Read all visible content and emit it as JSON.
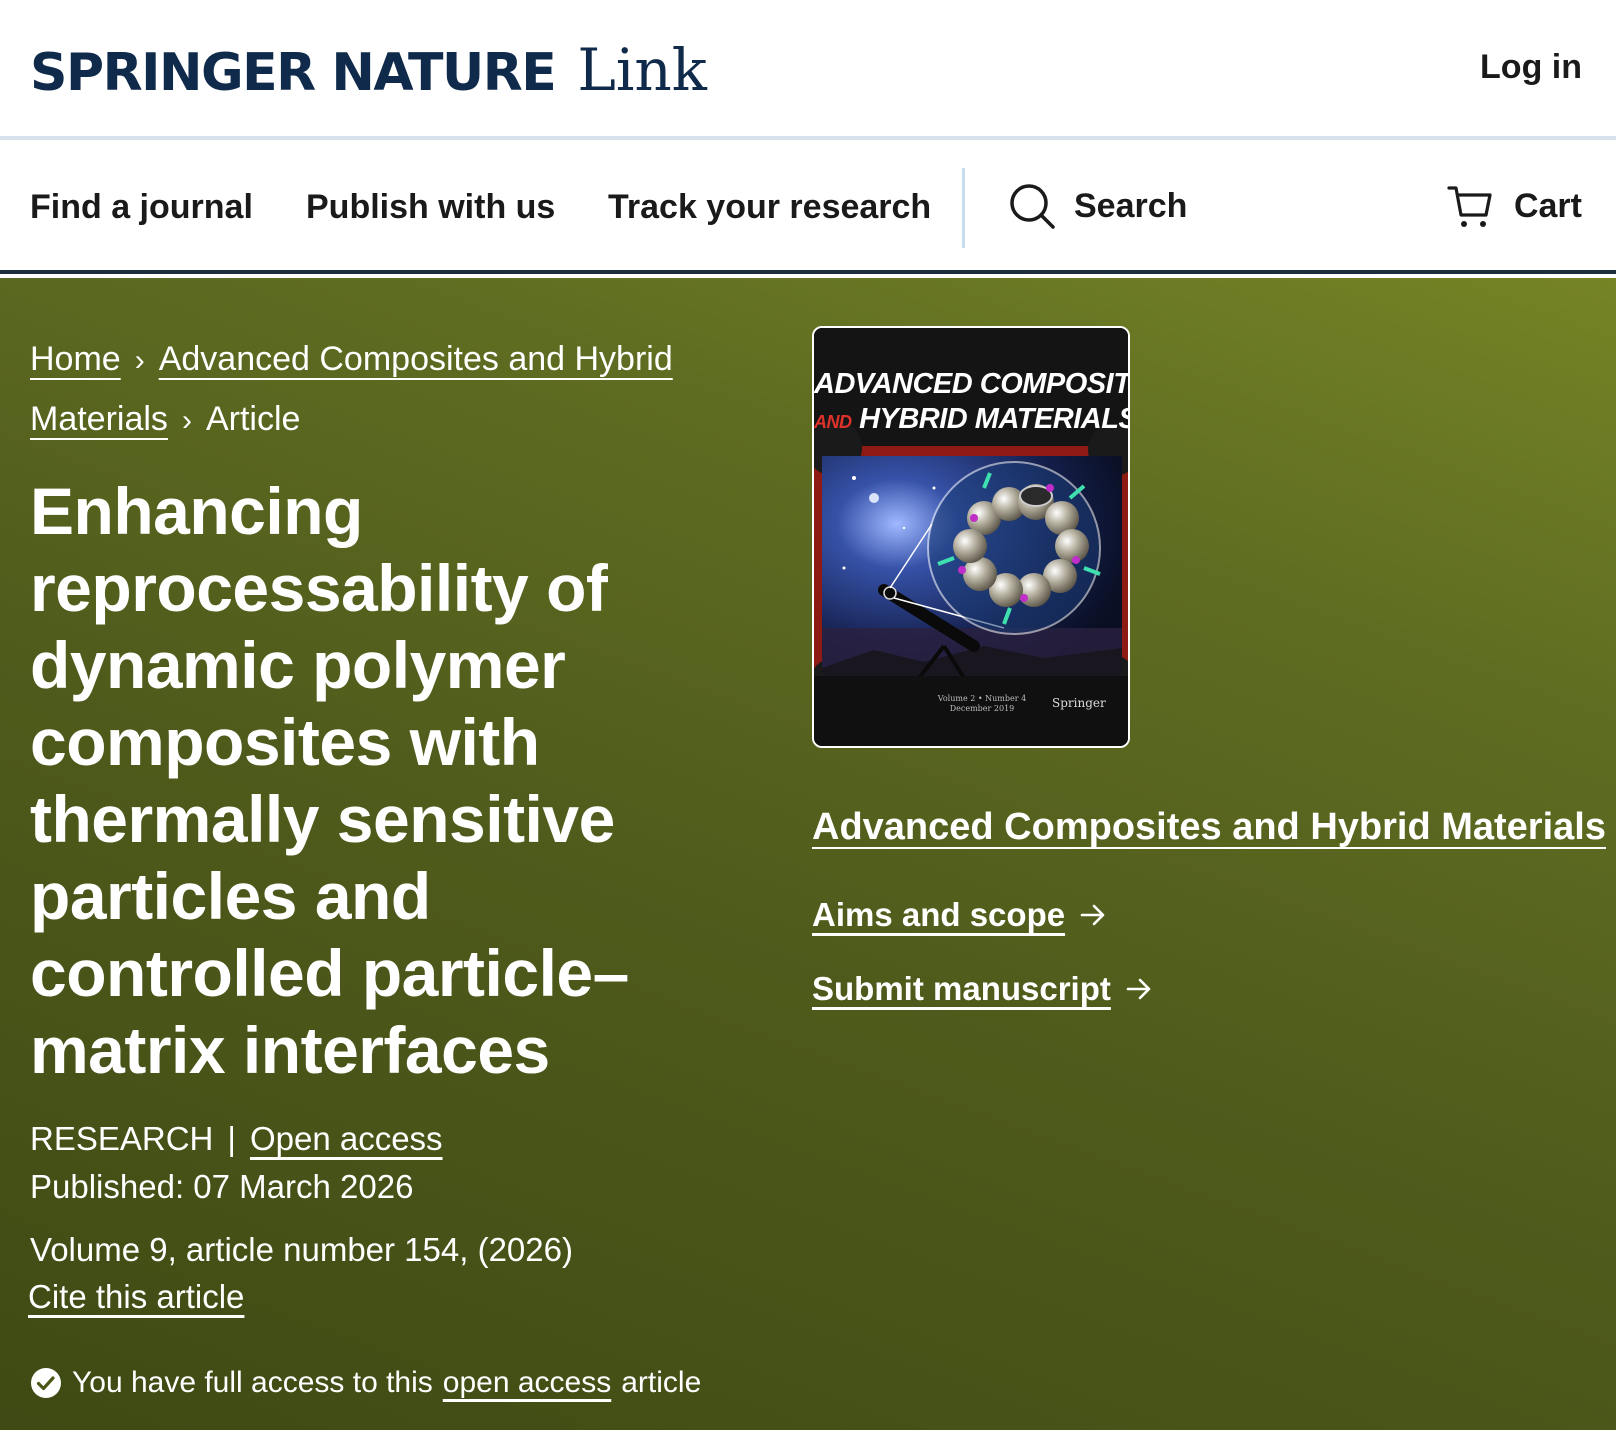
{
  "brand": {
    "main": "SPRINGER NATURE",
    "sub": "Link"
  },
  "header": {
    "login": "Log in"
  },
  "nav": {
    "find_journal": "Find a journal",
    "publish": "Publish with us",
    "track": "Track your research",
    "search": "Search",
    "cart": "Cart"
  },
  "breadcrumb": {
    "home": "Home",
    "journal": "Advanced Composites and Hybrid Materials",
    "current": "Article"
  },
  "article": {
    "title": "Enhancing reprocessability of dynamic polymer composites with thermally sensitive particles and controlled particle–matrix interfaces",
    "type": "RESEARCH",
    "access": "Open access",
    "published": "Published: 07 March 2026",
    "volume": "Volume 9, article number 154, (2026)",
    "cite": "Cite this article"
  },
  "access_notice": {
    "prefix": "You have full access to this",
    "link": "open access",
    "suffix": "article"
  },
  "cover": {
    "line1": "ADVANCED COMPOSITES",
    "line2_and": "AND",
    "line2_rest": "HYBRID MATERIALS",
    "publisher": "Springer",
    "issue_line1": "Volume 2 • Number 4",
    "issue_line2": "December 2019"
  },
  "journal_panel": {
    "name": "Advanced Composites and Hybrid Materials",
    "aims": "Aims and scope",
    "submit": "Submit manuscript"
  },
  "colors": {
    "brand_navy": "#0f2a4a",
    "hero_green": "#4f5b1b",
    "nav_border": "#1c2d3c"
  },
  "icons": [
    "search-icon",
    "cart-icon",
    "chevron-right-icon",
    "arrow-right-icon",
    "check-circle-icon"
  ]
}
